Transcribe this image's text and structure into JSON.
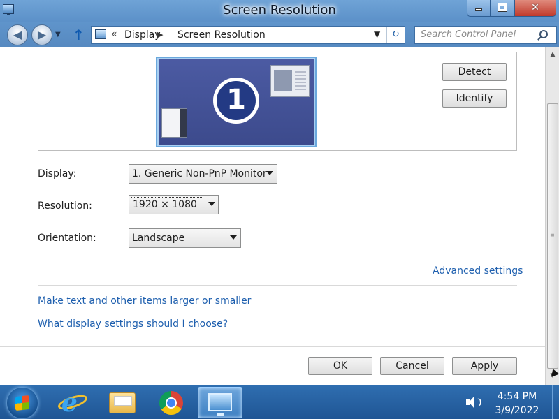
{
  "window": {
    "title": "Screen Resolution",
    "accent_color": "#5b90c8"
  },
  "nav": {
    "breadcrumb_chevron": "«",
    "breadcrumb": [
      "Display",
      "Screen Resolution"
    ],
    "search_placeholder": "Search Control Panel"
  },
  "monitor": {
    "number": "1"
  },
  "buttons": {
    "detect": "Detect",
    "identify": "Identify",
    "ok": "OK",
    "cancel": "Cancel",
    "apply": "Apply"
  },
  "fields": {
    "display_label": "Display:",
    "display_value": "1. Generic Non-PnP Monitor",
    "resolution_label": "Resolution:",
    "resolution_value": "1920 × 1080",
    "orientation_label": "Orientation:",
    "orientation_value": "Landscape"
  },
  "links": {
    "advanced": "Advanced settings",
    "text_size": "Make text and other items larger or smaller",
    "help": "What display settings should I choose?"
  },
  "taskbar": {
    "time": "4:54 PM",
    "date": "3/9/2022",
    "pinned": [
      "internet-explorer-icon",
      "file-explorer-icon",
      "chrome-icon",
      "screen-resolution-icon"
    ]
  }
}
